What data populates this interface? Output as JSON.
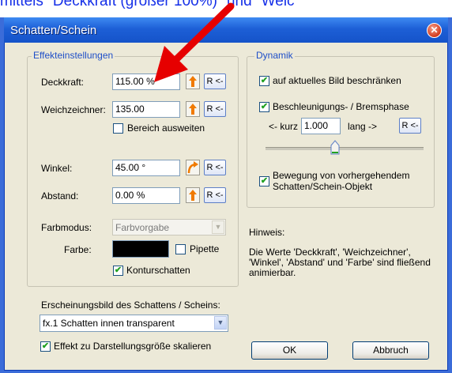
{
  "caption": "mittels \"Deckkraft (größer 100%)\" und \"Weic",
  "dialog": {
    "title": "Schatten/Schein",
    "effects": {
      "legend": "Effekteinstellungen",
      "opacity": {
        "label": "Deckkraft:",
        "value": "115.00 %"
      },
      "softener": {
        "label": "Weichzeichner:",
        "value": "135.00"
      },
      "expand_area": {
        "label": "Bereich ausweiten",
        "checked": false
      },
      "angle": {
        "label": "Winkel:",
        "value": "45.00 °"
      },
      "distance": {
        "label": "Abstand:",
        "value": "0.00 %"
      },
      "color_mode": {
        "label": "Farbmodus:",
        "value": "Farbvorgabe"
      },
      "color": {
        "label": "Farbe:",
        "swatch": "#000000"
      },
      "pipette": {
        "label": "Pipette",
        "checked": false
      },
      "contour_shadow": {
        "label": "Konturschatten",
        "checked": true
      },
      "reset_label": "R <-"
    },
    "appearance": {
      "label": "Erscheinungsbild des Schattens / Scheins:",
      "selected": "fx.1 Schatten innen transparent"
    },
    "scale_effect": {
      "label": "Effekt zu Darstellungsgröße skalieren",
      "checked": true
    },
    "dynamics": {
      "legend": "Dynamik",
      "limit_current": {
        "label": "auf aktuelles Bild beschränken",
        "checked": true
      },
      "accel_phase": {
        "label": "Beschleunigungs- / Bremsphase",
        "checked": true
      },
      "short_label": "<- kurz",
      "value": "1.000",
      "long_label": "lang ->",
      "reset_label": "R <-",
      "slider_value": 0.44,
      "motion_previous": {
        "label": "Bewegung von vorhergehendem Schatten/Schein-Objekt",
        "checked": true
      }
    },
    "hint": {
      "title": "Hinweis:",
      "text": "Die Werte 'Deckkraft', 'Weichzeichner', 'Winkel', 'Abstand' und 'Farbe' sind fließend animierbar."
    },
    "buttons": {
      "ok": "OK",
      "cancel": "Abbruch"
    }
  },
  "colors": {
    "accent_arrow": "#e60000",
    "title_bar": "#1d5fd6",
    "legend": "#1f4fc8",
    "orange": "#f07a00"
  }
}
